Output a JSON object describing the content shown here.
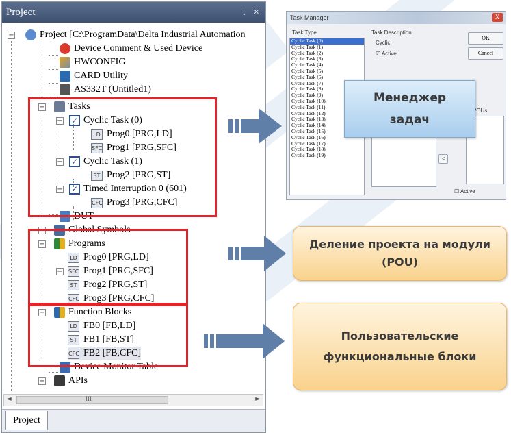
{
  "project_panel": {
    "title": "Project",
    "pin_glyph": "↓",
    "close_glyph": "×",
    "bottom_tab": "Project"
  },
  "tree": {
    "root": "Project [C:\\ProgramData\\Delta Industrial Automation",
    "device_comment": "Device Comment & Used Device",
    "hwconfig": "HWCONFIG",
    "card_utility": "CARD Utility",
    "plc": "AS332T  (Untitled1)",
    "tasks": "Tasks",
    "cyclic_task_0": "Cyclic Task (0)",
    "prog0_task": "Prog0 [PRG,LD]",
    "prog1_task": "Prog1 [PRG,SFC]",
    "cyclic_task_1": "Cyclic Task (1)",
    "prog2_task": "Prog2 [PRG,ST]",
    "timed_interruption": "Timed Interruption 0 (601)",
    "prog3_task": "Prog3 [PRG,CFC]",
    "dut": "DUT",
    "global_symbols": "Global Symbols",
    "programs": "Programs",
    "prog0": "Prog0 [PRG,LD]",
    "prog1": "Prog1 [PRG,SFC]",
    "prog2": "Prog2 [PRG,ST]",
    "prog3": "Prog3 [PRG,CFC]",
    "function_blocks": "Function Blocks",
    "fb0": "FB0 [FB,LD]",
    "fb1": "FB1 [FB,ST]",
    "fb2": "FB2 [FB,CFC]",
    "device_monitor": "Device Monitor Table",
    "apis": "APIs"
  },
  "scrollbar": {
    "thumb_glyph": "III",
    "left_arrow": "◄",
    "right_arrow": "►"
  },
  "task_manager": {
    "title": "Task Manager",
    "close": "X",
    "task_type_label": "Task Type",
    "task_description_label": "Task Description",
    "description_value": "Cyclic",
    "active_label": "☑ Active",
    "ok": "OK",
    "cancel": "Cancel",
    "pous_label": "POUs",
    "bottom_active": "☐ Active",
    "tasks": [
      "Cyclic Task (0)",
      "Cyclic Task (1)",
      "Cyclic Task (2)",
      "Cyclic Task (3)",
      "Cyclic Task (4)",
      "Cyclic Task (5)",
      "Cyclic Task (6)",
      "Cyclic Task (7)",
      "Cyclic Task (8)",
      "Cyclic Task (9)",
      "Cyclic Task (10)",
      "Cyclic Task (11)",
      "Cyclic Task (12)",
      "Cyclic Task (13)",
      "Cyclic Task (14)",
      "Cyclic Task (15)",
      "Cyclic Task (16)",
      "Cyclic Task (17)",
      "Cyclic Task (18)",
      "Cyclic Task (19)"
    ],
    "selected_index": 0
  },
  "callouts": {
    "task_manager": "Менеджер задач",
    "pou": "Деление проекта на модули (POU)",
    "function_blocks": "Пользовательские функциональные блоки"
  },
  "colors": {
    "highlight_red": "#e0262b",
    "arrow_blue": "#5f7fa8",
    "title_bar": "#4a5d7d"
  }
}
